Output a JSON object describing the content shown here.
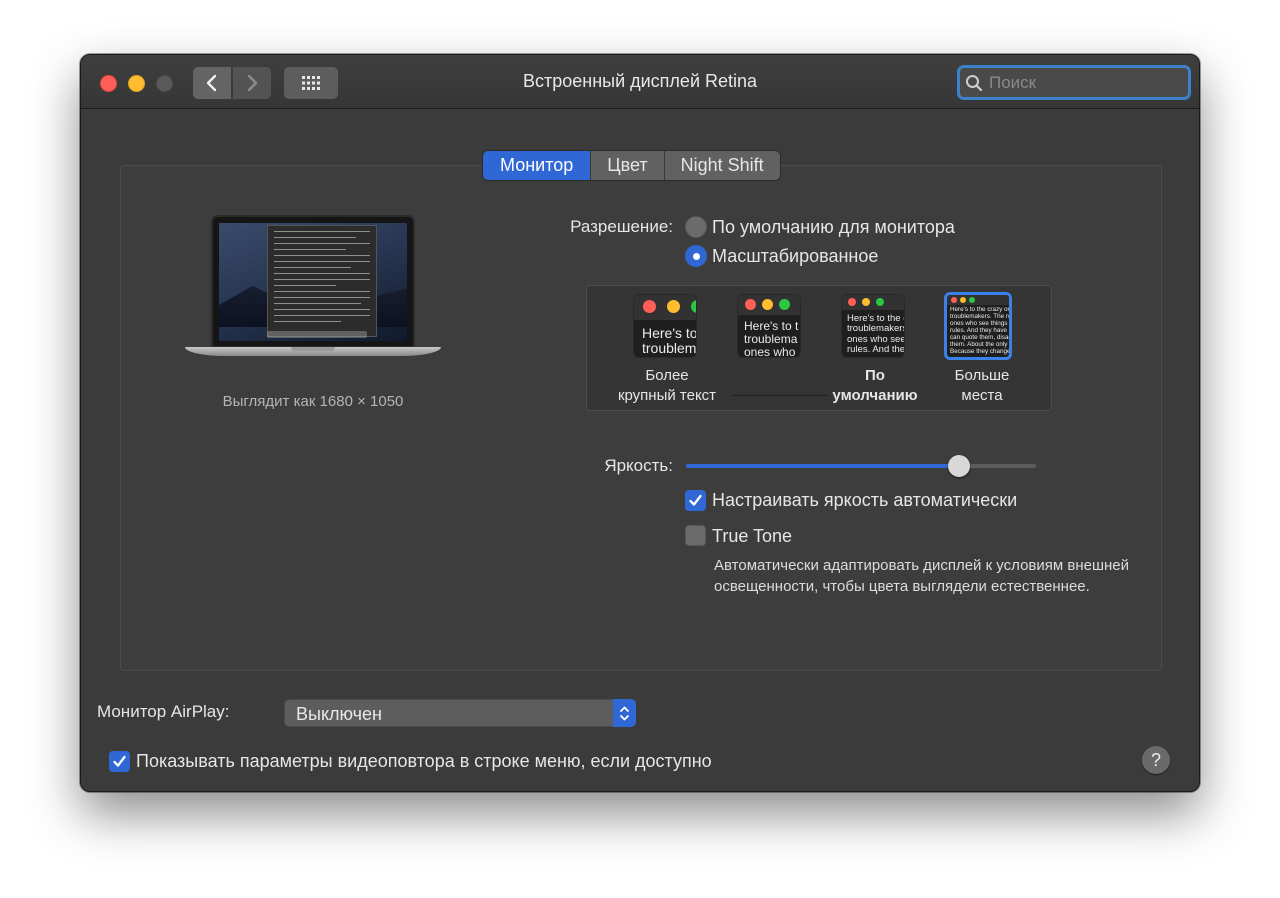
{
  "window": {
    "title": "Встроенный дисплей Retina",
    "search_placeholder": "Поиск"
  },
  "icons": {
    "close": "close-icon",
    "minimize": "minimize-icon",
    "zoom": "zoom-icon",
    "back": "chevron-left-icon",
    "forward": "chevron-right-icon",
    "grid": "grid-icon",
    "search": "search-icon",
    "help": "help-icon"
  },
  "tabs": [
    {
      "label": "Монитор",
      "active": true
    },
    {
      "label": "Цвет",
      "active": false
    },
    {
      "label": "Night Shift",
      "active": false
    }
  ],
  "preview": {
    "looks_like": "Выглядит как 1680 × 1050"
  },
  "resolution": {
    "label": "Разрешение:",
    "options": [
      {
        "label": "По умолчанию для монитора",
        "selected": false
      },
      {
        "label": "Масштабированное",
        "selected": true
      }
    ]
  },
  "scaled": {
    "thumbs": [
      {
        "text": "Here's to\ntroublem",
        "caption_line1": "Более",
        "caption_line2": "крупный текст"
      },
      {
        "text": "Here's to t\ntroublema\nones who",
        "caption_line1": "",
        "caption_line2": ""
      },
      {
        "text": "Here's to the cr\ntroublemakers.\nones who see t\nrules. And they",
        "caption_line1": "По",
        "caption_line2": "умолчанию"
      },
      {
        "text": "Here's to the crazy one\ntroublemakers. The rou\nones who see things di\nrules. And they have no\ncan quote them, disagr\nthem. About the only th\nBecause they change th",
        "caption_line1": "Больше",
        "caption_line2": "места"
      }
    ],
    "selected_index": 3
  },
  "brightness": {
    "label": "Яркость:",
    "value": 0.78,
    "auto_label": "Настраивать яркость автоматически",
    "auto_checked": true,
    "truetone_label": "True Tone",
    "truetone_checked": false,
    "truetone_desc": "Автоматически адаптировать дисплей к условиям внешней освещенности, чтобы цвета выглядели естественнее."
  },
  "airplay": {
    "label": "Монитор AirPlay:",
    "value": "Выключен"
  },
  "mirror_option": {
    "label": "Показывать параметры видеоповтора в строке меню, если доступно",
    "checked": true
  },
  "help_glyph": "?",
  "colors": {
    "accent": "#2f68d4",
    "window_bg": "#3b3b3b",
    "close": "#fe5f57",
    "minimize": "#febc2e"
  }
}
